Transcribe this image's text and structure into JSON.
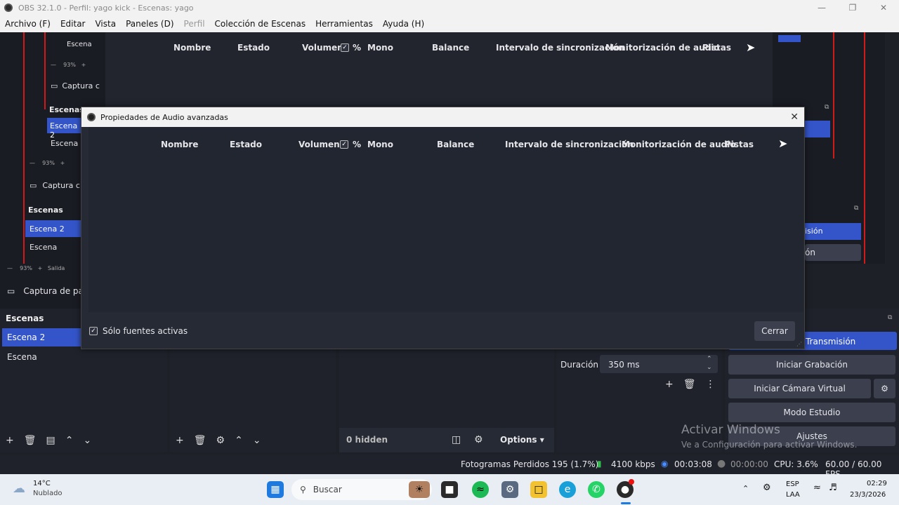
{
  "window": {
    "title": "OBS 32.1.0 - Perfil: yago kick - Escenas: yago"
  },
  "menu": [
    "Archivo (F)",
    "Editar",
    "Vista",
    "Paneles (D)",
    "Perfil",
    "Colección de Escenas",
    "Herramientas",
    "Ayuda (H)"
  ],
  "bg_mixer": {
    "columns": [
      "Nombre",
      "Estado",
      "Volumen",
      "%",
      "Mono",
      "Balance",
      "Intervalo de sincronización",
      "Monitorización de audio",
      "Pistas"
    ]
  },
  "nested": {
    "scene_tag": "Escena",
    "zoom": "93%",
    "capture": "Captura c",
    "capture_mid": "Captura c",
    "capture_full": "Captura de pa",
    "scenes_header": "Escenas",
    "scene2": "Escena 2",
    "scene": "Escena",
    "salida": "Salida"
  },
  "dialog": {
    "title": "Propiedades de Audio avanzadas",
    "columns": [
      "Nombre",
      "Estado",
      "Volumen",
      "%",
      "Mono",
      "Balance",
      "Intervalo de sincronización",
      "Monitorización de audio",
      "Pistas"
    ],
    "only_active_label": "Sólo fuentes activas",
    "only_active_checked": true,
    "close_label": "Cerrar"
  },
  "scenes_panel": {
    "header": "Escenas",
    "items": [
      "Escena 2",
      "Escena"
    ],
    "selected": "Escena 2"
  },
  "sources_panel": {
    "hidden": "0 hidden",
    "options": "Options"
  },
  "transitions": {
    "duration_label": "Duración",
    "duration_value": "350 ms"
  },
  "controls": {
    "stream": "Transmisión",
    "record": "Iniciar Grabación",
    "virtual_cam": "Iniciar Cámara Virtual",
    "studio": "Modo Estudio",
    "settings": "Ajustes",
    "right_partial1": "isión",
    "right_partial2": "ón"
  },
  "watermark": {
    "line1": "Activar Windows",
    "line2": "Ve a Configuración para activar Windows."
  },
  "status": {
    "dropped": "Fotogramas Perdidos 195 (1.7%)",
    "bitrate": "4100 kbps",
    "stream_time": "00:03:08",
    "rec_time": "00:00:00",
    "cpu": "CPU: 3.6%",
    "fps": "60.00 / 60.00 FPS"
  },
  "taskbar": {
    "temp": "14°C",
    "weather": "Nublado",
    "search": "Buscar",
    "lang1": "ESP",
    "lang2": "LAA",
    "time": "02:29",
    "date": "23/3/2026"
  },
  "colors": {
    "accent": "#3455c9",
    "bg": "#1e2028",
    "red": "#d21a1a"
  }
}
